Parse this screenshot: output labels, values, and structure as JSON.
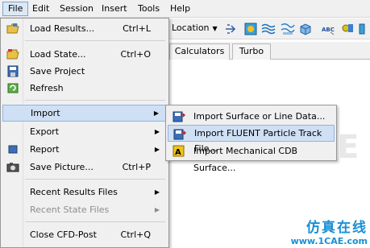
{
  "menubar": {
    "items": [
      "File",
      "Edit",
      "Session",
      "Insert",
      "Tools",
      "Help"
    ]
  },
  "toolbar": {
    "location_label": "Location"
  },
  "tabs": [
    "Calculators",
    "Turbo"
  ],
  "watermark": "1CAE",
  "file_menu": {
    "items": [
      {
        "label": "Load Results...",
        "shortcut": "Ctrl+L",
        "icon": "folder-open-icon"
      },
      {
        "label": "Load State...",
        "shortcut": "Ctrl+O",
        "icon": "folder-state-icon"
      },
      {
        "label": "Save Project",
        "shortcut": "",
        "icon": "save-project-icon"
      },
      {
        "label": "Refresh",
        "shortcut": "",
        "icon": "refresh-icon"
      },
      {
        "label": "Import",
        "shortcut": "",
        "icon": ""
      },
      {
        "label": "Export",
        "shortcut": "",
        "icon": ""
      },
      {
        "label": "Report",
        "shortcut": "",
        "icon": "report-icon"
      },
      {
        "label": "Save Picture...",
        "shortcut": "Ctrl+P",
        "icon": "camera-icon"
      },
      {
        "label": "Recent Results Files",
        "shortcut": "",
        "icon": ""
      },
      {
        "label": "Recent State Files",
        "shortcut": "",
        "icon": ""
      },
      {
        "label": "Close CFD-Post",
        "shortcut": "Ctrl+Q",
        "icon": ""
      }
    ]
  },
  "import_submenu": {
    "items": [
      {
        "label": "Import Surface or Line Data...",
        "icon": "import-surface-icon"
      },
      {
        "label": "Import FLUENT Particle Track File...",
        "icon": "import-fluent-icon"
      },
      {
        "label": "Import Mechanical CDB Surface...",
        "icon": "import-cdb-icon"
      }
    ]
  },
  "logo": {
    "cn": "仿真在线",
    "en": "www.1CAE.com"
  }
}
